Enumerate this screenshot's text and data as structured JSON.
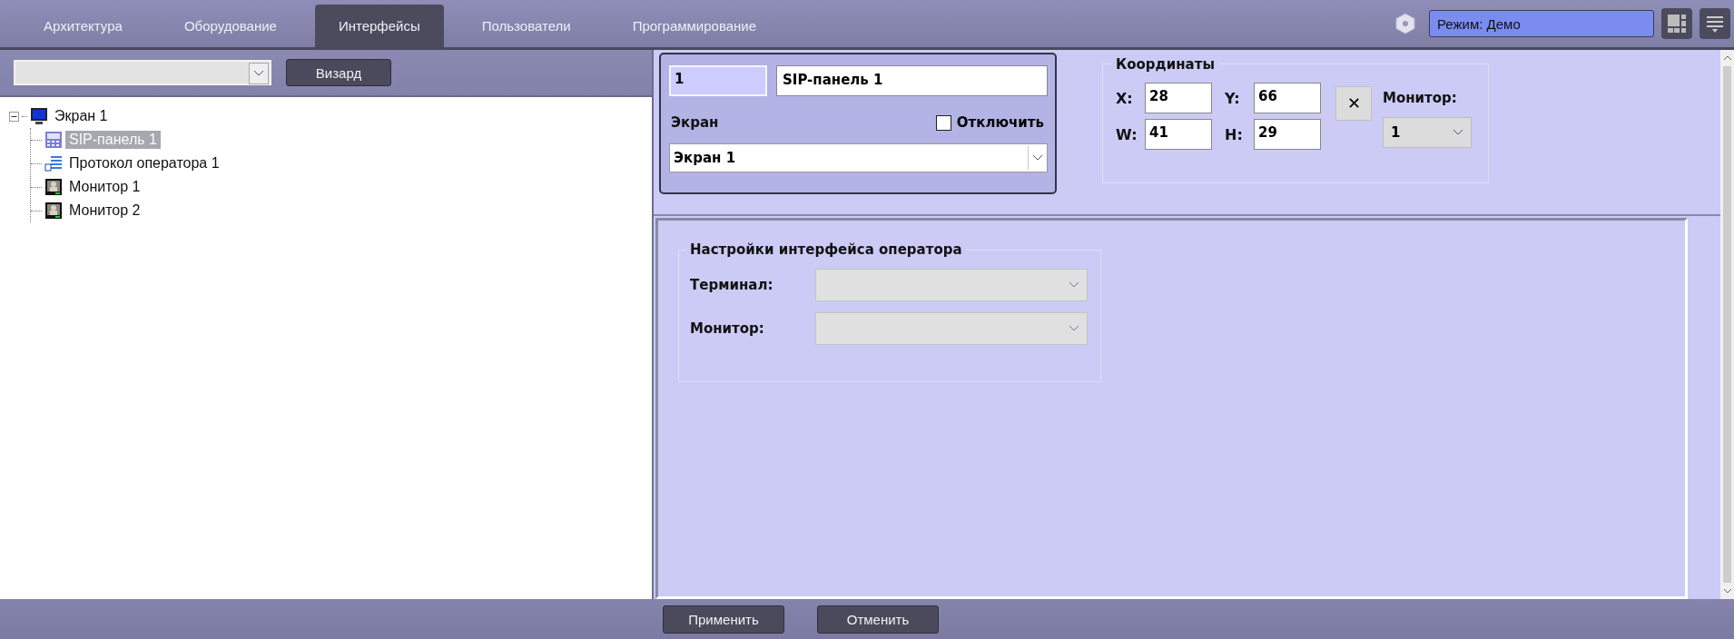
{
  "tabs": [
    {
      "label": "Архитектура",
      "selected": false
    },
    {
      "label": "Оборудование",
      "selected": false
    },
    {
      "label": "Интерфейсы",
      "selected": true
    },
    {
      "label": "Пользователи",
      "selected": false
    },
    {
      "label": "Программирование",
      "selected": false
    }
  ],
  "mode_field": {
    "value": "Режим: Демо"
  },
  "left_toolbar": {
    "button": "Визард"
  },
  "tree": [
    {
      "label": "Экран 1",
      "kind": "screen",
      "expanded": true,
      "selected": false,
      "children": [
        {
          "label": "SIP-панель 1",
          "kind": "sip",
          "selected": true
        },
        {
          "label": "Протокол оператора 1",
          "kind": "log",
          "selected": false
        },
        {
          "label": "Монитор 1",
          "kind": "monitor",
          "selected": false
        },
        {
          "label": "Монитор 2",
          "kind": "monitor",
          "selected": false
        }
      ]
    }
  ],
  "object": {
    "id": "1",
    "name": "SIP-панель 1",
    "screen_label": "Экран",
    "disable": {
      "label": "Отключить",
      "checked": false
    },
    "screen_value": "Экран 1"
  },
  "coordinates": {
    "title": "Координаты",
    "fields": [
      {
        "label": "X:",
        "value": "28"
      },
      {
        "label": "Y:",
        "value": "66"
      },
      {
        "label": "W:",
        "value": "41"
      },
      {
        "label": "H:",
        "value": "29"
      }
    ],
    "clear_button": "✕",
    "monitor_label": "Монитор:",
    "monitor_value": "1"
  },
  "settings": {
    "title": "Настройки интерфейса оператора",
    "rows": [
      {
        "label": "Терминал:",
        "disabled": true
      },
      {
        "label": "Монитор:",
        "disabled": true
      }
    ]
  },
  "buttons": [
    "Применить",
    "Отменить"
  ]
}
